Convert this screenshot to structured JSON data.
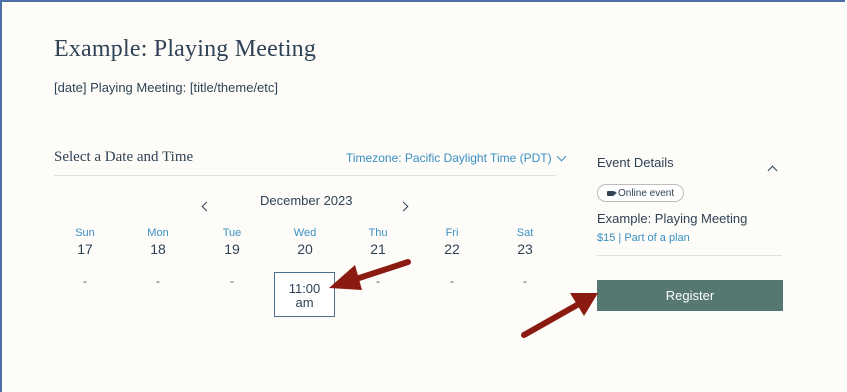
{
  "page": {
    "title": "Example: Playing Meeting",
    "subtitle": "[date] Playing Meeting: [title/theme/etc]"
  },
  "scheduler": {
    "heading": "Select a Date and Time",
    "timezone_label": "Timezone: Pacific Daylight Time (PDT)",
    "month_label": "December 2023",
    "days": [
      {
        "name": "Sun",
        "date": "17",
        "slot": "-"
      },
      {
        "name": "Mon",
        "date": "18",
        "slot": "-"
      },
      {
        "name": "Tue",
        "date": "19",
        "slot": "-"
      },
      {
        "name": "Wed",
        "date": "20",
        "slot": ""
      },
      {
        "name": "Thu",
        "date": "21",
        "slot": "-"
      },
      {
        "name": "Fri",
        "date": "22",
        "slot": "-"
      },
      {
        "name": "Sat",
        "date": "23",
        "slot": "-"
      }
    ],
    "time_slot": {
      "time": "11:00",
      "period": "am"
    }
  },
  "event_details": {
    "heading": "Event Details",
    "badge": "Online event",
    "name": "Example: Playing Meeting",
    "price_info": "$15 | Part of a plan",
    "register_label": "Register"
  },
  "icons": {
    "prev": "chevron-left-icon",
    "next": "chevron-right-icon",
    "timezone": "chevron-down-icon",
    "collapse": "chevron-up-icon",
    "badge": "video-camera-icon"
  },
  "colors": {
    "accent": "#3a8fc4",
    "text": "#2f4256",
    "button": "#567873",
    "annotation_arrow": "#8b1a10",
    "frame_border": "#4a6fa5"
  }
}
